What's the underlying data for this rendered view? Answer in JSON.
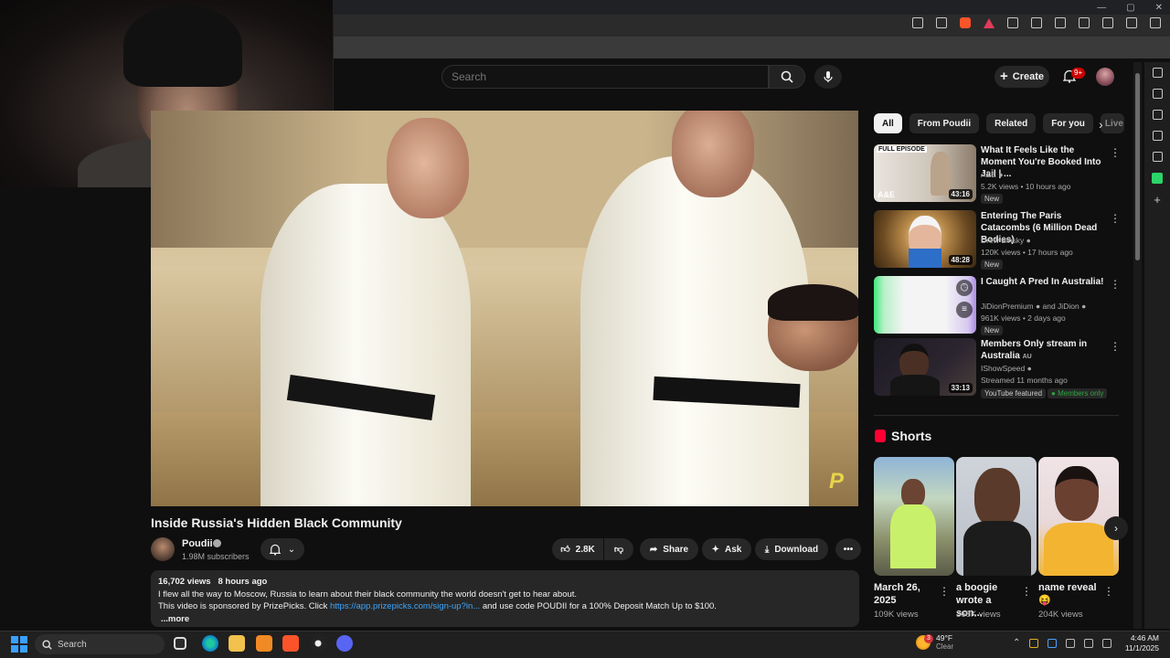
{
  "youtube": {
    "search_placeholder": "Search",
    "create_label": "Create",
    "notifications_badge": "9+"
  },
  "video": {
    "title": "Inside Russia's Hidden Black Community",
    "watermark": "P",
    "channel": "Poudii",
    "subscribers": "1.98M subscribers",
    "likes": "2.8K",
    "share_label": "Share",
    "ask_label": "Ask",
    "download_label": "Download",
    "views": "16,702 views",
    "uploaded": "8 hours ago",
    "description_line1": "I flew all the way to Moscow, Russia to learn about their black community the world doesn't get to hear about.",
    "description_line2_prefix": "This video is sponsored by PrizePicks. Click ",
    "description_link": "https://app.prizepicks.com/sign-up?in...",
    "description_line2_suffix": " and use code POUDII for a 100% Deposit Match Up to $100.",
    "more_label": "...more"
  },
  "chips": [
    "All",
    "From Poudii",
    "Related",
    "For you",
    "Live"
  ],
  "recommendations": [
    {
      "title": "What It Feels Like the Moment You're Booked Into Jail | ...",
      "channel": "A&E",
      "meta": "5.2K views • 10 hours ago",
      "badge": "New",
      "duration": "43:16",
      "thumb_label": "FULL EPISODE",
      "thumb_logo": "A&E"
    },
    {
      "title": "Entering The Paris Catacombs (6 Million Dead Bodies)",
      "channel": "Drew Binsky",
      "meta": "120K views • 17 hours ago",
      "badge": "New",
      "duration": "48:28"
    },
    {
      "title": "I Caught A Pred In Australia!",
      "channel": "JiDionPremium",
      "channel_extra": "and JiDion",
      "meta": "961K views • 2 days ago",
      "badge": "New"
    },
    {
      "title": "Members Only stream in Australia",
      "title_suffix": "AU",
      "channel": "IShowSpeed",
      "meta": "Streamed 11 months ago",
      "badge": "YouTube featured",
      "badge2": "Members only",
      "duration": "33:13"
    }
  ],
  "shorts": {
    "heading": "Shorts",
    "items": [
      {
        "title": "March 26, 2025",
        "views": "109K views"
      },
      {
        "title": "a boogie wrote a son...",
        "views": "368K views"
      },
      {
        "title": "name reveal",
        "emoji": "😝",
        "views": "204K views"
      }
    ]
  },
  "taskbar": {
    "search_label": "Search",
    "weather_temp": "49°F",
    "weather_desc": "Clear",
    "weather_badge": "3",
    "time": "4:46 AM",
    "date": "11/1/2025"
  },
  "colors": {
    "accent_red": "#ff0033",
    "link_blue": "#3ea6ff",
    "members_green": "#2ba640"
  }
}
